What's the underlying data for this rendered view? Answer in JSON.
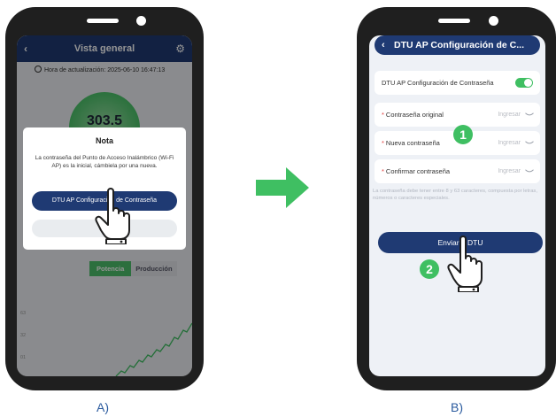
{
  "colors": {
    "header_navy": "#1f3a73",
    "accent_green": "#3fbf62",
    "required_red": "#e23b3b"
  },
  "panel_a": {
    "header": {
      "title": "Vista general",
      "back_icon": "chevron-left-icon",
      "settings_icon": "gear-icon"
    },
    "update_time": "Hora de actualización: 2025-06-10 16:47:13",
    "power_value": "303.5",
    "tabs": [
      {
        "label": "Potencia",
        "active": true
      },
      {
        "label": "Producción",
        "active": false
      }
    ],
    "chart_ticks": [
      "63",
      "32",
      "01"
    ],
    "dialog": {
      "title": "Nota",
      "message": "La contraseña del Punto de Acceso Inalámbrico (Wi-Fi AP) es la inicial, cámbiela por una nueva.",
      "primary_button": "DTU AP Configuración de Contraseña"
    },
    "caption": "A)"
  },
  "panel_b": {
    "header": {
      "title": "DTU AP Configuración de C...",
      "back_icon": "chevron-left-icon"
    },
    "toggle": {
      "label": "DTU AP Configuración de Contraseña",
      "on": true
    },
    "fields": [
      {
        "label": "Contraseña original",
        "placeholder": "Ingresar",
        "required": "*"
      },
      {
        "label": "Nueva contraseña",
        "placeholder": "Ingresar",
        "required": "*"
      },
      {
        "label": "Confirmar contraseña",
        "placeholder": "Ingresar",
        "required": "*"
      }
    ],
    "hint": "La contraseña debe tener entre 8 y 63 caracteres, compuesta por letras, números o caracteres especiales.",
    "send_button": "Enviar a DTU",
    "steps": [
      "1",
      "2"
    ],
    "caption": "B)"
  }
}
